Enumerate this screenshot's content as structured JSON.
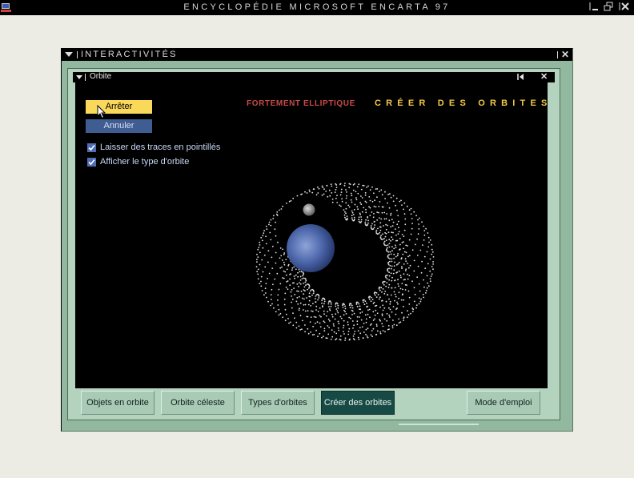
{
  "app": {
    "title": "ENCYCLOPÉDIE MICROSOFT ENCARTA 97"
  },
  "window": {
    "title": "INTERACTIVITÉS"
  },
  "panel": {
    "title": "Orbite"
  },
  "controls": {
    "stop_label": "Arrêter",
    "cancel_label": "Annuler",
    "options": [
      {
        "label": "Laisser des traces en pointillés",
        "checked": true
      },
      {
        "label": "Afficher le type d'orbite",
        "checked": true
      }
    ]
  },
  "display": {
    "orbit_type": "FORTEMENT ELLIPTIQUE",
    "heading": "CRÉER DES ORBITES"
  },
  "tabs": [
    {
      "label": "Objets en orbite",
      "active": false
    },
    {
      "label": "Orbite céleste",
      "active": false
    },
    {
      "label": "Types d'orbites",
      "active": false
    },
    {
      "label": "Créer des orbites",
      "active": true
    },
    {
      "label": "Mode d'emploi",
      "active": false
    }
  ],
  "colors": {
    "accent_yellow": "#f9d85a",
    "title_red": "#c74b48",
    "title_gold": "#f2c84b",
    "planet_blue": "#5a75b8",
    "frame_green": "#93b8a0"
  },
  "icons": [
    "app-icon",
    "minimize-icon",
    "restore-icon",
    "close-icon",
    "dropdown-icon",
    "back-icon",
    "checkmark-icon",
    "mouse-cursor-icon"
  ]
}
